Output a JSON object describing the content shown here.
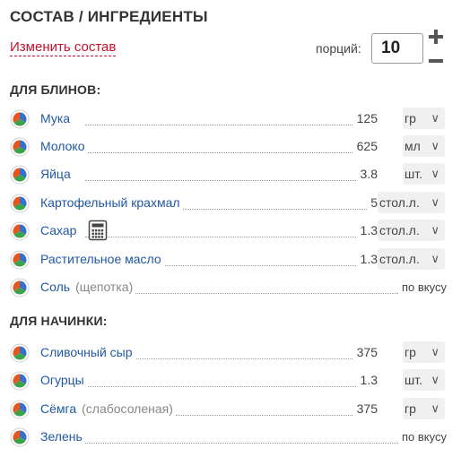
{
  "title": "СОСТАВ / ИНГРЕДИЕНТЫ",
  "edit_link": "Изменить состав",
  "portions": {
    "label": "порций:",
    "value": "10"
  },
  "colors": {
    "link": "#2058a0",
    "edit": "#c8102e",
    "unit_bg": "#f0f0f0"
  },
  "icons": {
    "ingredient": "pie-chart-icon",
    "calc": "calculator-icon",
    "chevron": "chevron-down-icon"
  },
  "sections": [
    {
      "heading": "ДЛЯ БЛИНОВ:",
      "items": [
        {
          "name": "Мука",
          "qty": "125",
          "unit": "гр"
        },
        {
          "name": "Молоко",
          "qty": "625",
          "unit": "мл"
        },
        {
          "name": "Яйца",
          "qty": "3.8",
          "unit": "шт."
        },
        {
          "name": "Картофельный крахмал",
          "qty": "5",
          "unit": "стол.л."
        },
        {
          "name": "Сахар",
          "qty": "1.3",
          "unit": "стол.л.",
          "calc": true
        },
        {
          "name": "Растительное масло",
          "qty": "1.3",
          "unit": "стол.л."
        },
        {
          "name": "Соль",
          "note": "(щепотка)",
          "taste": "по вкусу"
        }
      ]
    },
    {
      "heading": "ДЛЯ НАЧИНКИ:",
      "items": [
        {
          "name": "Сливочный сыр",
          "qty": "375",
          "unit": "гр"
        },
        {
          "name": "Огурцы",
          "qty": "1.3",
          "unit": "шт."
        },
        {
          "name": "Сёмга",
          "note": "(слабосоленая)",
          "qty": "375",
          "unit": "гр"
        },
        {
          "name": "Зелень",
          "taste": "по вкусу"
        }
      ]
    }
  ]
}
